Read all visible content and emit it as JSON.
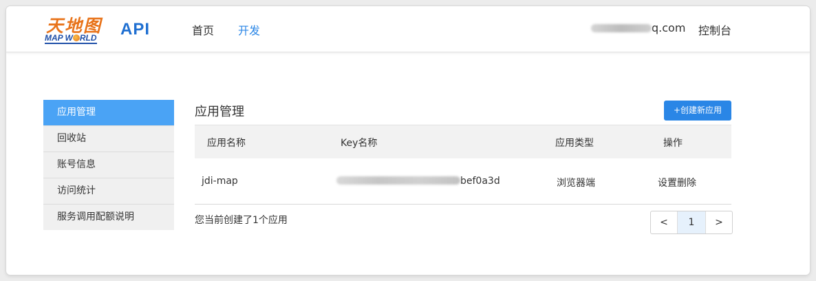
{
  "brand": {
    "logo_cn": "天地图",
    "logo_en_left": "MAP W",
    "logo_en_right": "RLD",
    "api_label": "API",
    "accent_color": "#2a86e6"
  },
  "nav": {
    "items": [
      {
        "label": "首页",
        "active": false
      },
      {
        "label": "开发",
        "active": true
      }
    ]
  },
  "user": {
    "email_suffix": "q.com",
    "console_label": "控制台"
  },
  "sidebar": {
    "items": [
      {
        "label": "应用管理",
        "active": true
      },
      {
        "label": "回收站",
        "active": false
      },
      {
        "label": "账号信息",
        "active": false
      },
      {
        "label": "访问统计",
        "active": false
      },
      {
        "label": "服务调用配额说明",
        "active": false
      }
    ]
  },
  "main": {
    "title": "应用管理",
    "create_button": "+创建新应用",
    "table": {
      "headers": [
        "应用名称",
        "Key名称",
        "应用类型",
        "操作"
      ],
      "rows": [
        {
          "name": "jdi-map",
          "key_suffix": "bef0a3d",
          "type": "浏览器端",
          "action_settings": "设置",
          "action_delete": "删除"
        }
      ]
    },
    "summary": "您当前创建了1个应用"
  },
  "pagination": {
    "prev": "<",
    "current": "1",
    "next": ">"
  }
}
